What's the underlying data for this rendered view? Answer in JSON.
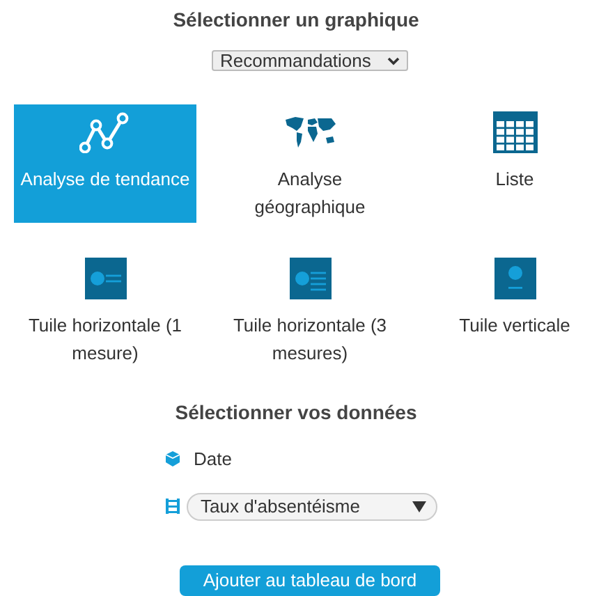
{
  "chart_section": {
    "title": "Sélectionner un graphique",
    "filter": {
      "value": "Recommandations"
    },
    "charts": [
      {
        "kind": "trend",
        "label": "Analyse de tendance",
        "selected": true
      },
      {
        "kind": "map",
        "label": "Analyse géographique",
        "selected": false
      },
      {
        "kind": "table",
        "label": "Liste",
        "selected": false
      },
      {
        "kind": "tile-h1",
        "label": "Tuile horizontale (1 mesure)",
        "selected": false
      },
      {
        "kind": "tile-h3",
        "label": "Tuile horizontale (3 mesures)",
        "selected": false
      },
      {
        "kind": "tile-v",
        "label": "Tuile verticale",
        "selected": false
      }
    ]
  },
  "data_section": {
    "title": "Sélectionner vos données",
    "dimension": {
      "label": "Date"
    },
    "measure": {
      "value": "Taux d'absentéisme"
    }
  },
  "add_button": {
    "label": "Ajouter au tableau de bord"
  }
}
